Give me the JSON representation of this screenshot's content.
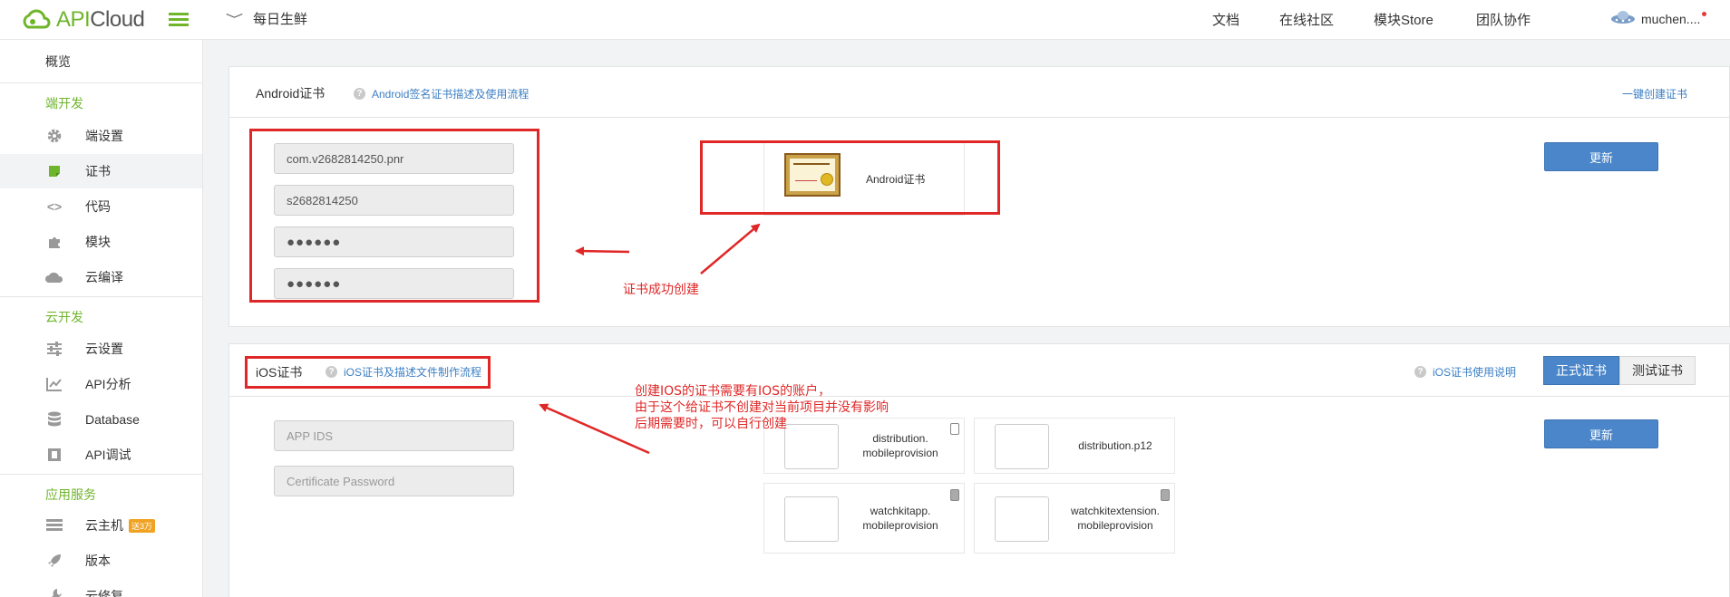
{
  "header": {
    "logo_text": "APICloud",
    "project_name": "每日生鲜",
    "nav": [
      "文档",
      "在线社区",
      "模块Store",
      "团队协作"
    ],
    "user": "muchen...."
  },
  "sidebar": {
    "overview": "概览",
    "section_client": "端开发",
    "client_items": [
      {
        "label": "端设置",
        "icon": "gear-icon"
      },
      {
        "label": "证书",
        "icon": "certificate-icon"
      },
      {
        "label": "代码",
        "icon": "code-icon"
      },
      {
        "label": "模块",
        "icon": "puzzle-icon"
      },
      {
        "label": "云编译",
        "icon": "cloud-icon"
      }
    ],
    "section_cloud": "云开发",
    "cloud_items": [
      {
        "label": "云设置",
        "icon": "sliders-icon"
      },
      {
        "label": "API分析",
        "icon": "chart-icon"
      },
      {
        "label": "Database",
        "icon": "database-icon"
      },
      {
        "label": "API调试",
        "icon": "debug-icon"
      }
    ],
    "section_services": "应用服务",
    "service_items": [
      {
        "label": "云主机",
        "icon": "server-icon",
        "badge": "送3万"
      },
      {
        "label": "版本",
        "icon": "rocket-icon"
      },
      {
        "label": "云修复",
        "icon": "wrench-icon"
      }
    ]
  },
  "android": {
    "title": "Android证书",
    "help": "Android签名证书描述及使用流程",
    "one_click": "一键创建证书",
    "package": "com.v2682814250.pnr",
    "alias": "s2682814250",
    "password1": "●●●●●●",
    "password2": "●●●●●●",
    "cert_label": "Android证书",
    "update": "更新"
  },
  "ios": {
    "title": "iOS证书",
    "help": "iOS证书及描述文件制作流程",
    "usage": "iOS证书使用说明",
    "tab_prod": "正式证书",
    "tab_test": "测试证书",
    "app_ids_placeholder": "APP IDS",
    "cert_pw_placeholder": "Certificate Password",
    "update": "更新",
    "tiles": [
      {
        "line1": "distribution.",
        "line2": "mobileprovision"
      },
      {
        "line1": "distribution.p12",
        "line2": ""
      },
      {
        "line1": "watchkitapp.",
        "line2": "mobileprovision"
      },
      {
        "line1": "watchkitextension.",
        "line2": "mobileprovision"
      }
    ]
  },
  "annotations": {
    "cert_created": "证书成功创建",
    "ios_note_1": "创建IOS的证书需要有IOS的账户，",
    "ios_note_2": "由于这个给证书不创建对当前项目并没有影响",
    "ios_note_3": "后期需要时，可以自行创建"
  },
  "colors": {
    "brand_green": "#6fb52c",
    "primary_blue": "#4a86c9",
    "annotation_red": "#e02727"
  }
}
